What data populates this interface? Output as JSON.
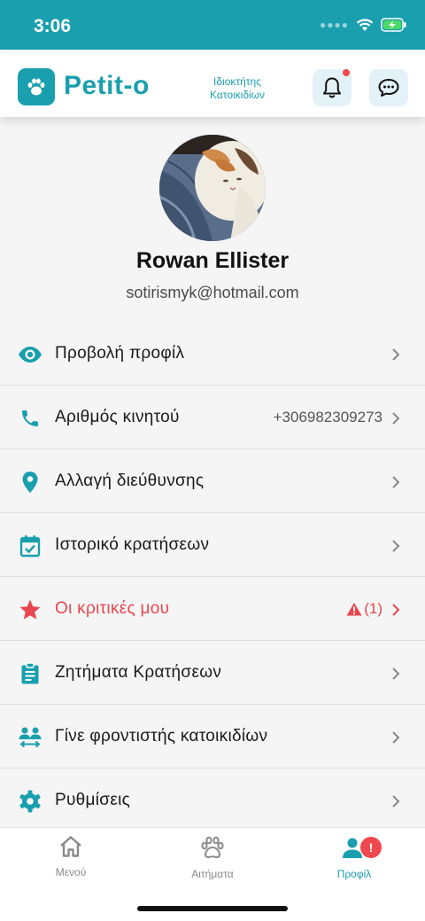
{
  "status_bar": {
    "time": "3:06"
  },
  "header": {
    "brand": "Petit-o",
    "role_line1": "Ιδιοκτήτης",
    "role_line2": "Κατοικιδίων"
  },
  "profile": {
    "name": "Rowan Ellister",
    "email": "sotirismyk@hotmail.com"
  },
  "menu": {
    "items": [
      {
        "label": "Προβολή προφίλ",
        "icon": "eye-icon"
      },
      {
        "label": "Αριθμός κινητού",
        "icon": "phone-icon",
        "value": "+306982309273"
      },
      {
        "label": "Αλλαγή διεύθυνσης",
        "icon": "location-pin-icon"
      },
      {
        "label": "Ιστορικό κρατήσεων",
        "icon": "calendar-check-icon"
      },
      {
        "label": "Οι κριτικές μου",
        "icon": "star-icon",
        "warning_count": "(1)"
      },
      {
        "label": "Ζητήματα Κρατήσεων",
        "icon": "clipboard-icon"
      },
      {
        "label": "Γίνε φροντιστής κατοικιδίων",
        "icon": "people-swap-icon"
      },
      {
        "label": "Ρυθμίσεις",
        "icon": "gear-icon"
      }
    ]
  },
  "tabbar": {
    "tabs": [
      {
        "label": "Μενού",
        "icon": "home-icon"
      },
      {
        "label": "Αιτήματα",
        "icon": "paw-icon"
      },
      {
        "label": "Προφίλ",
        "icon": "user-icon",
        "badge": "!"
      }
    ],
    "active": "Προφίλ"
  },
  "colors": {
    "primary": "#1a9fae",
    "danger": "#e8474f",
    "background": "#f5f5f5"
  }
}
